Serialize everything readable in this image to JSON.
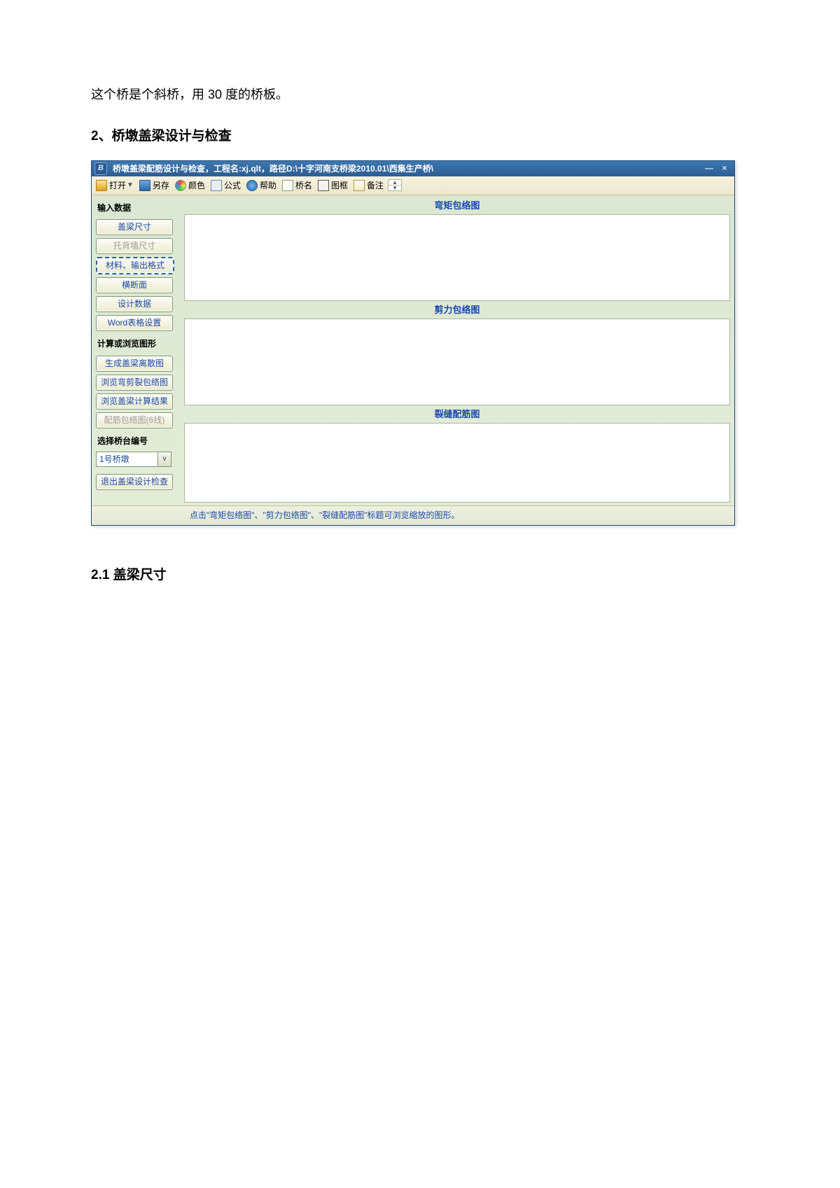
{
  "doc": {
    "intro": "这个桥是个斜桥，用 30 度的桥板。",
    "heading2": "2、桥墩盖梁设计与检查",
    "heading2_1": "2.1 盖梁尺寸"
  },
  "app": {
    "title": "桥墩盖梁配筋设计与检查，工程名:xj.qlt，路径D:\\十字河南支桥梁2010.01\\西集生产桥\\",
    "toolbar": {
      "open": "打开",
      "saveas": "另存",
      "color": "颜色",
      "formula": "公式",
      "help": "帮助",
      "bridgename": "桥名",
      "frame": "图框",
      "note": "备注"
    },
    "sidebar": {
      "group_input": "输入数据",
      "btn_dim": "盖梁尺寸",
      "btn_bearing": "托背墙尺寸",
      "btn_material": "材料、输出格式",
      "btn_section": "横断面",
      "btn_design": "设计数据",
      "btn_word": "Word表格设置",
      "group_calc": "计算或浏览图形",
      "btn_gen": "生成盖梁离散图",
      "btn_view_env": "浏览弯剪裂包络图",
      "btn_view_res": "浏览盖梁计算结果",
      "btn_rebar_disabled": "配筋包络图(6线)",
      "group_pier": "选择桥台编号",
      "pier_selected": "1号桥墩",
      "btn_exit": "退出盖梁设计检查"
    },
    "plots": {
      "moment": "弯矩包络图",
      "shear": "剪力包络图",
      "crack": "裂缝配筋图"
    },
    "status": "点击\"弯矩包络图\"、\"剪力包络图\"、\"裂缝配筋图\"标题可浏览缩放的图形。"
  }
}
